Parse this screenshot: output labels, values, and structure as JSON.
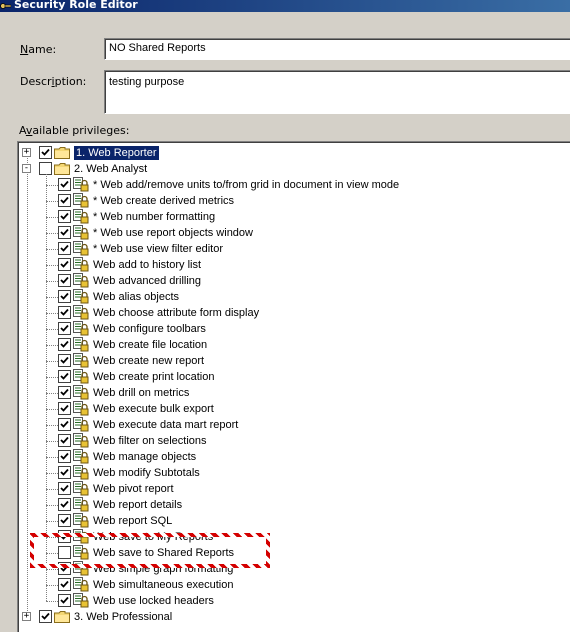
{
  "window": {
    "title": "Security Role Editor"
  },
  "form": {
    "name_label_u": "N",
    "name_label_rest": "ame:",
    "name_value": "NO Shared Reports",
    "description_label_pre": "Descr",
    "description_label_u": "i",
    "description_label_post": "ption:",
    "description_value": "testing purpose",
    "privileges_label_pre": "A",
    "privileges_label_u": "v",
    "privileges_label_post": "ailable privileges:"
  },
  "tree": {
    "groups": [
      {
        "label": "1. Web Reporter",
        "expander": "+",
        "checked": true,
        "selected": true
      },
      {
        "label": "2. Web Analyst",
        "expander": "-",
        "checked": false,
        "selected": false
      },
      {
        "label": "3. Web Professional",
        "expander": "+",
        "checked": true,
        "selected": false
      }
    ],
    "items": [
      {
        "label": "* Web add/remove units to/from grid in document in view mode",
        "checked": true
      },
      {
        "label": "* Web create derived metrics",
        "checked": true
      },
      {
        "label": "* Web number formatting",
        "checked": true
      },
      {
        "label": "* Web use report objects window",
        "checked": true
      },
      {
        "label": "* Web use view filter editor",
        "checked": true
      },
      {
        "label": "Web add to history list",
        "checked": true
      },
      {
        "label": "Web advanced drilling",
        "checked": true
      },
      {
        "label": "Web alias objects",
        "checked": true
      },
      {
        "label": "Web choose attribute form display",
        "checked": true
      },
      {
        "label": "Web configure toolbars",
        "checked": true
      },
      {
        "label": "Web create file location",
        "checked": true
      },
      {
        "label": "Web create new report",
        "checked": true
      },
      {
        "label": "Web create print location",
        "checked": true
      },
      {
        "label": "Web drill on metrics",
        "checked": true
      },
      {
        "label": "Web execute bulk export",
        "checked": true
      },
      {
        "label": "Web execute data mart report",
        "checked": true
      },
      {
        "label": "Web filter on selections",
        "checked": true
      },
      {
        "label": "Web manage objects",
        "checked": true
      },
      {
        "label": "Web modify Subtotals",
        "checked": true
      },
      {
        "label": "Web pivot report",
        "checked": true
      },
      {
        "label": "Web report details",
        "checked": true
      },
      {
        "label": "Web report SQL",
        "checked": true
      },
      {
        "label": "Web save to My Reports",
        "checked": true
      },
      {
        "label": "Web save to Shared Reports",
        "checked": false,
        "highlighted": true
      },
      {
        "label": "Web simple graph formatting",
        "checked": true
      },
      {
        "label": "Web simultaneous execution",
        "checked": true
      },
      {
        "label": "Web use locked headers",
        "checked": true
      }
    ]
  },
  "icons": {
    "title_icon": "key-icon",
    "group_icon": "folder-icon",
    "item_icon": "privilege-lock-icon",
    "check": "checkmark-icon"
  },
  "colors": {
    "title_bar": "#0a246a",
    "selection": "#0a246a",
    "highlight_box": "#d40000",
    "dialog_bg": "#d4d0c8"
  }
}
